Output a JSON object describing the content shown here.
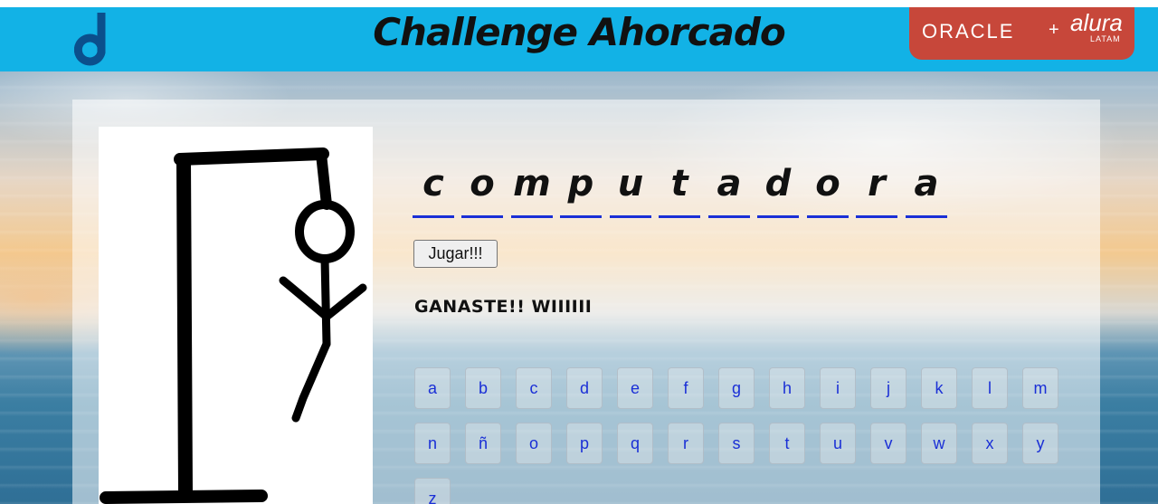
{
  "header": {
    "title": "Challenge Ahorcado",
    "brand": {
      "oracle": "ORACLE",
      "plus": "+",
      "alura": "alura",
      "latam": "LATAM"
    }
  },
  "game": {
    "letters": [
      "c",
      "o",
      "m",
      "p",
      "u",
      "t",
      "a",
      "d",
      "o",
      "r",
      "a"
    ],
    "play_label": "Jugar!!!",
    "status": "GANASTE!! WIIIIII"
  },
  "keyboard": {
    "row1": [
      "a",
      "b",
      "c",
      "d",
      "e",
      "f",
      "g",
      "h",
      "i",
      "j",
      "k",
      "l",
      "m"
    ],
    "row2": [
      "n",
      "ñ",
      "o",
      "p",
      "q",
      "r",
      "s",
      "t",
      "u",
      "v",
      "w",
      "x",
      "y"
    ],
    "row3": [
      "z"
    ]
  },
  "colors": {
    "header_bg": "#12b2e6",
    "brand_bg": "#c7473a",
    "accent_blue": "#1a2fd6"
  }
}
